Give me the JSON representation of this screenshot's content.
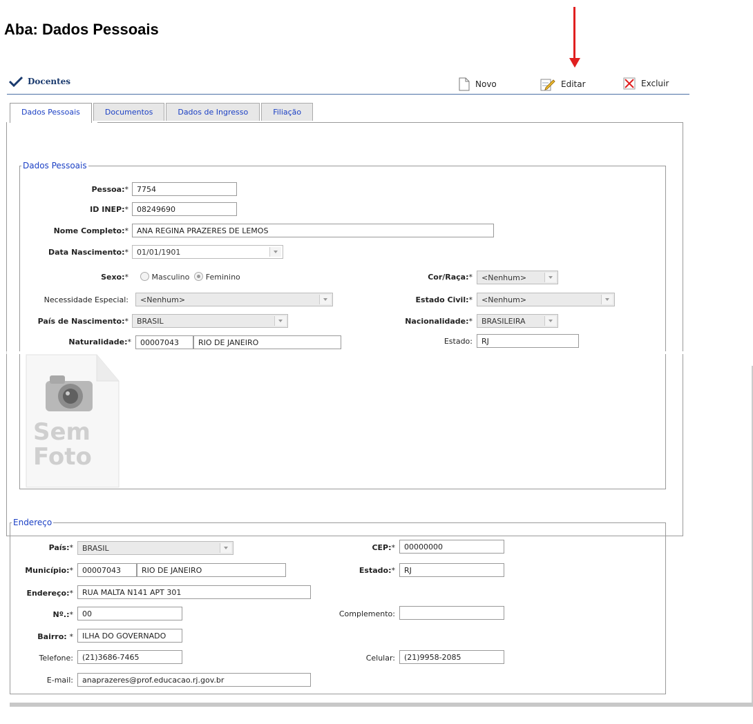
{
  "doc_heading": "Aba: Dados Pessoais",
  "module_title": "Docentes",
  "toolbar": {
    "novo": "Novo",
    "editar": "Editar",
    "excluir": "Excluir"
  },
  "tabs": [
    "Dados Pessoais",
    "Documentos",
    "Dados de Ingresso",
    "Filiação"
  ],
  "dados_pessoais": {
    "legend": "Dados Pessoais",
    "pessoa": {
      "label": "Pessoa:",
      "value": "7754"
    },
    "id_inep": {
      "label": "ID INEP:",
      "value": "08249690"
    },
    "nome": {
      "label": "Nome Completo:",
      "value": "ANA REGINA PRAZERES DE LEMOS"
    },
    "data_nasc": {
      "label": "Data Nascimento:",
      "value": "01/01/1901"
    },
    "sexo": {
      "label": "Sexo:",
      "masculino": "Masculino",
      "feminino": "Feminino",
      "selected": "Feminino"
    },
    "cor_raca": {
      "label": "Cor/Raça:",
      "value": "<Nenhum>"
    },
    "necessidade": {
      "label": "Necessidade Especial:",
      "value": "<Nenhum>"
    },
    "estado_civil": {
      "label": "Estado Civil:",
      "value": "<Nenhum>"
    },
    "pais_nasc": {
      "label": "País de Nascimento:",
      "value": "BRASIL"
    },
    "nacionalidade": {
      "label": "Nacionalidade:",
      "value": "BRASILEIRA"
    },
    "naturalidade": {
      "label": "Naturalidade:",
      "code": "00007043",
      "name": "RIO DE JANEIRO"
    },
    "estado": {
      "label": "Estado:",
      "value": "RJ"
    },
    "photo_text_1": "Sem",
    "photo_text_2": "Foto"
  },
  "endereco": {
    "legend": "Endereço",
    "pais": {
      "label": "País:",
      "value": "BRASIL"
    },
    "cep": {
      "label": "CEP:",
      "value": "00000000"
    },
    "municipio": {
      "label": "Município:",
      "code": "00007043",
      "name": "RIO DE JANEIRO"
    },
    "estado": {
      "label": "Estado:",
      "value": "RJ"
    },
    "endereco": {
      "label": "Endereço:",
      "value": "RUA MALTA N141 APT 301"
    },
    "numero": {
      "label": "Nº.:",
      "value": "00"
    },
    "complemento": {
      "label": "Complemento:",
      "value": ""
    },
    "bairro": {
      "label": "Bairro: ",
      "value": "ILHA DO GOVERNADO"
    },
    "telefone": {
      "label": "Telefone:",
      "value": "(21)3686-7465"
    },
    "celular": {
      "label": "Celular:",
      "value": "(21)9958-2085"
    },
    "email": {
      "label": "E-mail:",
      "value": "anaprazeres@prof.educacao.rj.gov.br"
    }
  },
  "required_mark": "*",
  "colors": {
    "accent": "#1a3fc4",
    "arrow": "#e02020",
    "title": "#1a3a6e"
  }
}
